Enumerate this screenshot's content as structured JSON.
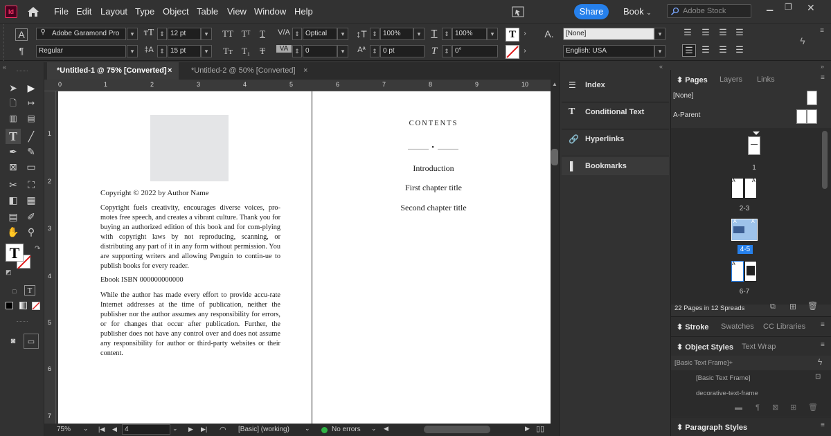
{
  "app": {
    "badge": "Id"
  },
  "menu": [
    "File",
    "Edit",
    "Layout",
    "Type",
    "Object",
    "Table",
    "View",
    "Window",
    "Help"
  ],
  "top_right": {
    "share": "Share",
    "workspace": "Book",
    "search_placeholder": "Adobe Stock"
  },
  "control": {
    "font_family": "Adobe Garamond Pro",
    "font_style": "Regular",
    "font_size": "12 pt",
    "leading": "15 pt",
    "kerning": "Optical",
    "tracking": "0",
    "vscale": "100%",
    "hscale": "100%",
    "baseline": "0 pt",
    "skew": "0°",
    "char_style": "[None]",
    "language": "English: USA"
  },
  "tabs": [
    {
      "label": "*Untitled-1 @ 75% [Converted]",
      "close": "×"
    },
    {
      "label": "*Untitled-2 @ 50% [Converted]",
      "close": "×"
    }
  ],
  "ruler_h": [
    "0",
    "1",
    "2",
    "3",
    "4",
    "5",
    "6",
    "7",
    "8",
    "9",
    "10"
  ],
  "ruler_v": [
    "1",
    "2",
    "3",
    "4",
    "5",
    "6",
    "7"
  ],
  "page_left": {
    "copyright_line": "Copyright © 2022 by Author Name",
    "para1": "Copyright fuels creativity, encourages diverse voices, pro-motes free speech, and creates a vibrant culture. Thank you for buying an authorized edition of this book and for com-plying with copyright laws by not reproducing, scanning, or distributing any part of it in any form without permission. You are supporting writers and allowing Penguin to contin-ue to publish books for every reader.",
    "isbn": "Ebook ISBN 000000000000",
    "para2": "While the author has made every effort to provide accu-rate Internet addresses at the time of publication, neither the publisher nor the author assumes any responsibility for errors, or for changes that occur after publication. Further, the publisher does not have any control over and does not assume any responsibility for author or third-party websites or their content."
  },
  "page_right": {
    "contents_title": "CONTENTS",
    "ornament": "•",
    "entries": [
      "Introduction",
      "First chapter title",
      "Second chapter title"
    ]
  },
  "status": {
    "zoom": "75%",
    "page": "4",
    "style": "[Basic] (working)",
    "errors": "No errors"
  },
  "mid_panel": [
    "Index",
    "Conditional Text",
    "Hyperlinks",
    "Bookmarks"
  ],
  "pages_panel": {
    "tabs": [
      "Pages",
      "Layers",
      "Links"
    ],
    "masters": [
      "[None]",
      "A-Parent"
    ],
    "spreads": [
      "1",
      "2-3",
      "4-5",
      "6-7"
    ],
    "summary": "22 Pages in 12 Spreads"
  },
  "stroke_panel": {
    "tabs": [
      "Stroke",
      "Swatches",
      "CC Libraries"
    ]
  },
  "object_styles": {
    "tabs": [
      "Object Styles",
      "Text Wrap"
    ],
    "items": [
      "[Basic Text Frame]+",
      "[Basic Text Frame]",
      "decorative-text-frame"
    ]
  },
  "paragraph_styles": {
    "title": "Paragraph Styles"
  },
  "colors": {
    "accent": "#2680eb",
    "selected_spread": "#9ec3ea",
    "ok": "#2fb344"
  }
}
